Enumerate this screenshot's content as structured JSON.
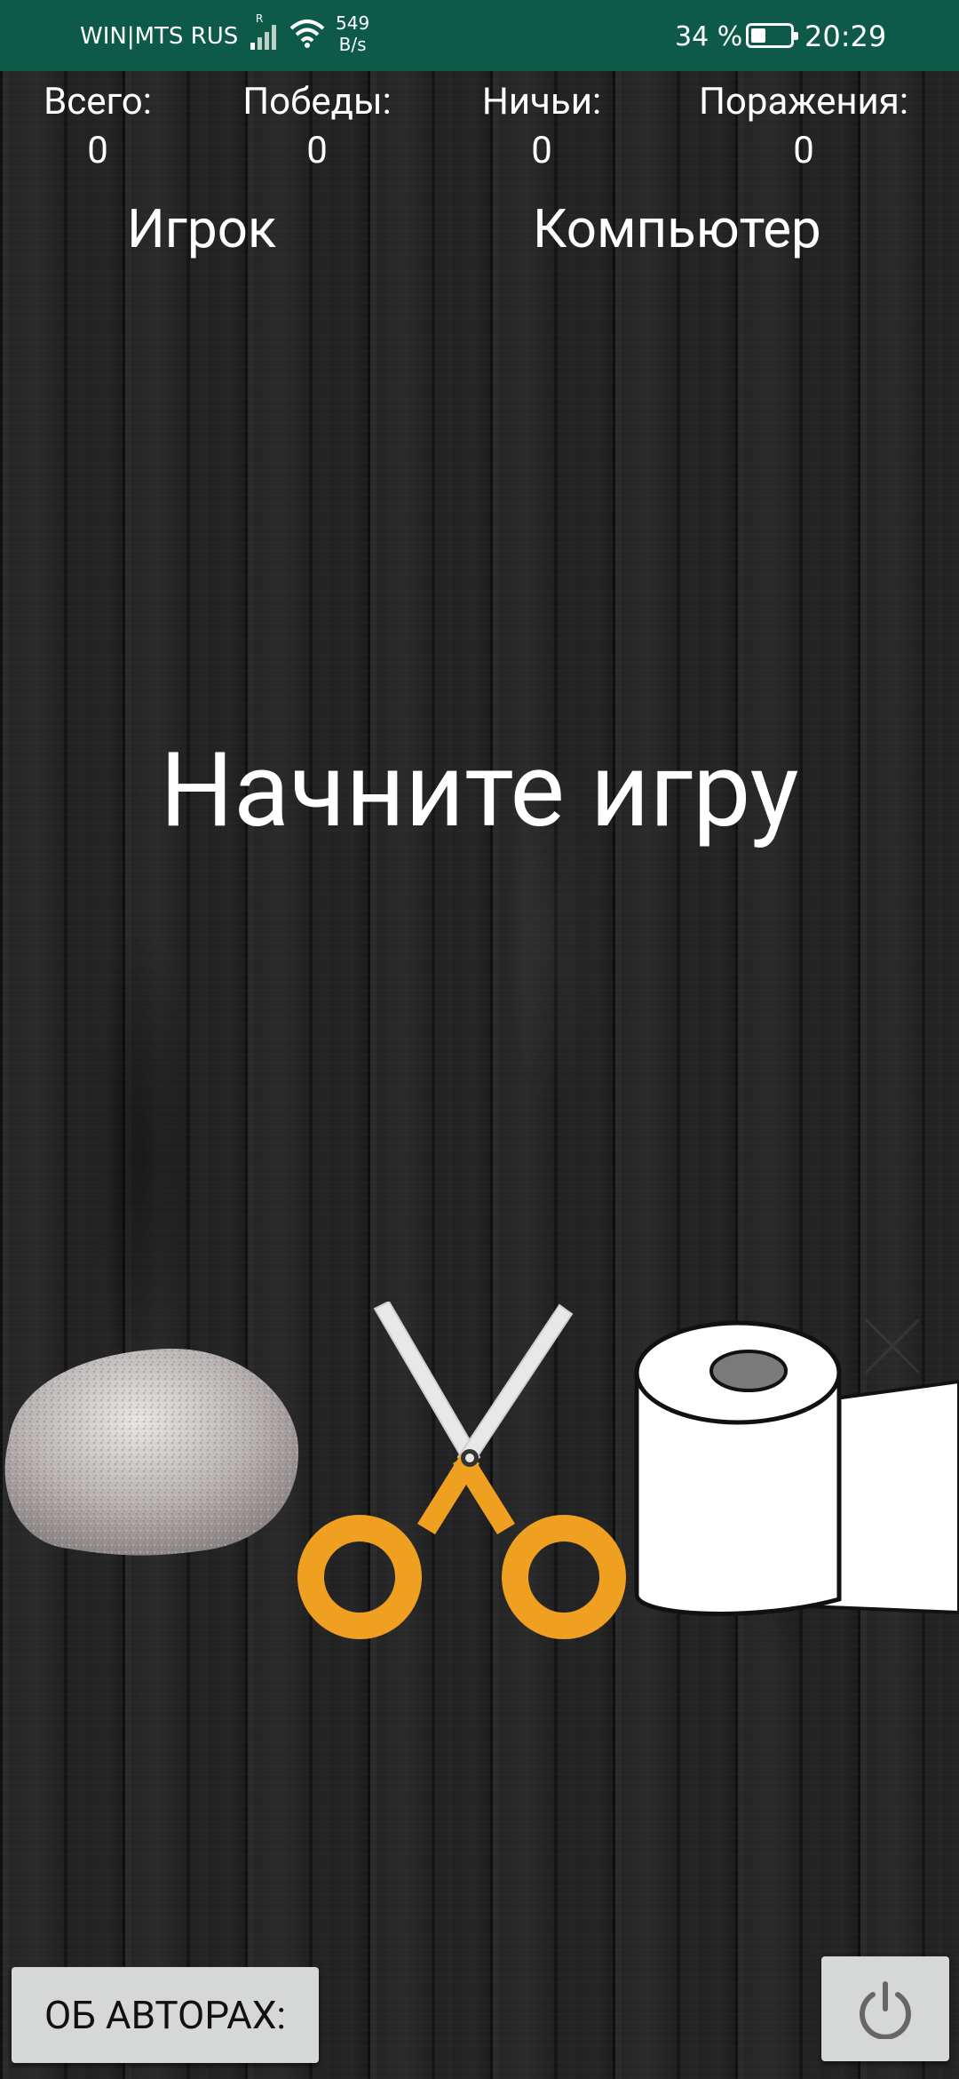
{
  "status_bar": {
    "carrier": "WIN|MTS RUS",
    "network_speed": "549",
    "network_speed_unit": "B/s",
    "battery_percent": "34 %",
    "battery_level": 0.34,
    "time": "20:29",
    "signal_icon": "signal-icon",
    "wifi_icon": "wifi-icon",
    "battery_icon": "battery-icon"
  },
  "scoreboard": {
    "total_label": "Всего:",
    "total_value": "0",
    "wins_label": "Победы:",
    "wins_value": "0",
    "draws_label": "Ничьи:",
    "draws_value": "0",
    "losses_label": "Поражения:",
    "losses_value": "0"
  },
  "sides": {
    "player": "Игрок",
    "computer": "Компьютер"
  },
  "message": "Начните игру",
  "choices": [
    {
      "name": "stone",
      "icon": "stone-icon"
    },
    {
      "name": "scissors",
      "icon": "scissors-icon"
    },
    {
      "name": "paper",
      "icon": "paper-roll-icon"
    }
  ],
  "buttons": {
    "about_label": "ОБ АВТОРАХ:",
    "power_icon": "power-icon"
  },
  "colors": {
    "status_bar": "#0d5a49",
    "button_bg": "#d6d7d7",
    "scissors_handle": "#f0a020"
  }
}
